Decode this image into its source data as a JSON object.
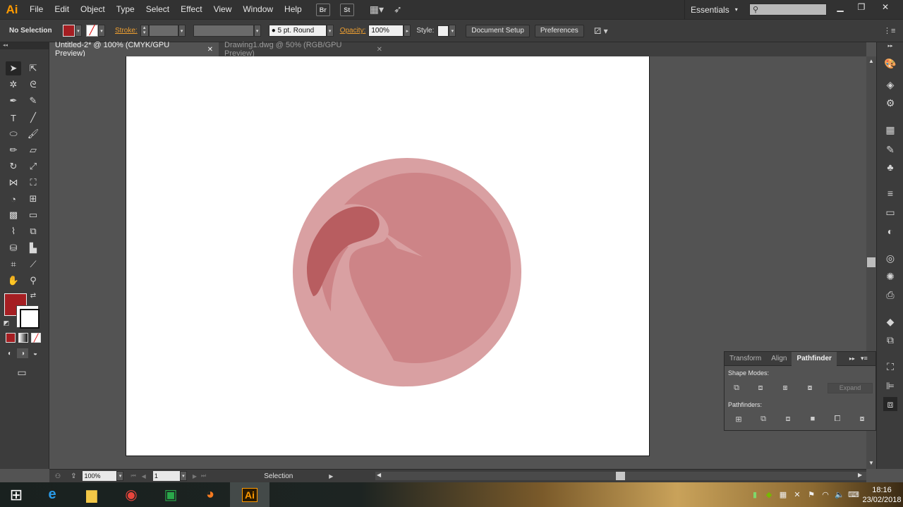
{
  "app": {
    "logo": "Ai"
  },
  "menu": [
    "File",
    "Edit",
    "Object",
    "Type",
    "Select",
    "Effect",
    "View",
    "Window",
    "Help"
  ],
  "menubar_buttons": {
    "br": "Br",
    "st": "St"
  },
  "workspace": "Essentials",
  "control_bar": {
    "selection": "No Selection",
    "stroke_label": "Stroke:",
    "brush": "5 pt. Round",
    "opacity_label": "Opacity:",
    "opacity_value": "100%",
    "style_label": "Style:",
    "document_setup": "Document Setup",
    "preferences": "Preferences"
  },
  "tabs": [
    {
      "label": "Untitled-2* @ 100% (CMYK/GPU Preview)",
      "active": true
    },
    {
      "label": "Drawing1.dwg @ 50% (RGB/GPU Preview)",
      "active": false
    }
  ],
  "colors": {
    "fill": "#a51e22",
    "circle_outer": "#d9a0a2",
    "circle_inner": "#cd8487",
    "bird_wing": "#b85d60",
    "bird_body": "#c97d80"
  },
  "pathfinder": {
    "tabs": [
      "Transform",
      "Align",
      "Pathfinder"
    ],
    "active_tab": "Pathfinder",
    "shape_modes_label": "Shape Modes:",
    "pathfinders_label": "Pathfinders:",
    "expand_label": "Expand"
  },
  "status": {
    "zoom": "100%",
    "artboard": "1",
    "tool": "Selection"
  },
  "taskbar": {
    "time": "18:16",
    "date": "23/02/2018"
  }
}
